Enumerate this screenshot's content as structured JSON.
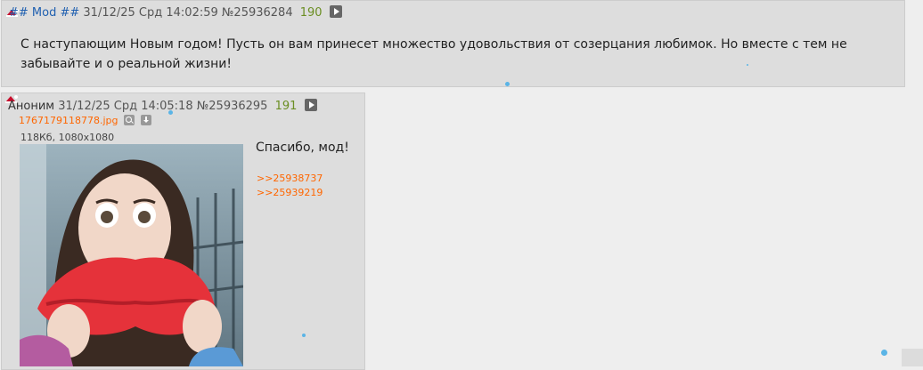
{
  "op_post": {
    "name": "## Mod ##",
    "date": "31/12/25 Срд 14:02:59",
    "number": "№25936284",
    "count": "190",
    "text": "С наступающим Новым годом! Пусть он вам принесет множество удовольствия от созерцания любимок. Но вместе с тем не забывайте и о реальной жизни!"
  },
  "reply_post": {
    "name": "Аноним",
    "date": "31/12/25 Срд 14:05:18",
    "number": "№25936295",
    "count": "191",
    "file": {
      "name": "1767179118778.jpg",
      "meta": "118Кб, 1080x1080"
    },
    "text": "Спасибо, мод!",
    "replies": [
      ">>25938737",
      ">>25939219"
    ]
  },
  "colors": {
    "background": "#eeeeee",
    "post": "#dddddd",
    "mod": "#2060b0",
    "link": "#ff6600",
    "count": "#6b8e23"
  }
}
